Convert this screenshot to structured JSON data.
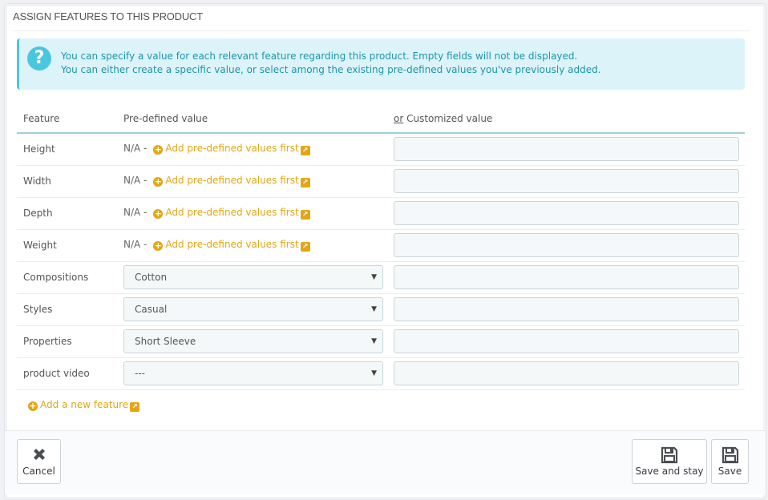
{
  "panel": {
    "title": "Assign features to this product"
  },
  "alert": {
    "icon": "question-circle-icon",
    "line1": "You can specify a value for each relevant feature regarding this product. Empty fields will not be displayed.",
    "line2": "You can either create a specific value, or select among the existing pre-defined values you've previously added."
  },
  "table": {
    "headers": {
      "feature": "Feature",
      "predefined": "Pre-defined value",
      "or": "or",
      "custom": "Customized value"
    },
    "na_label": "N/A -",
    "add_predefined_label": "Add pre-defined values first",
    "rows": [
      {
        "feature": "Height",
        "type": "na",
        "custom_value": ""
      },
      {
        "feature": "Width",
        "type": "na",
        "custom_value": ""
      },
      {
        "feature": "Depth",
        "type": "na",
        "custom_value": ""
      },
      {
        "feature": "Weight",
        "type": "na",
        "custom_value": ""
      },
      {
        "feature": "Compositions",
        "type": "select",
        "selected": "Cotton",
        "custom_value": ""
      },
      {
        "feature": "Styles",
        "type": "select",
        "selected": "Casual",
        "custom_value": ""
      },
      {
        "feature": "Properties",
        "type": "select",
        "selected": "Short Sleeve",
        "custom_value": ""
      },
      {
        "feature": "product video",
        "type": "select",
        "selected": "---",
        "custom_value": ""
      }
    ]
  },
  "add_feature_label": "Add a new feature",
  "footer": {
    "cancel_label": "Cancel",
    "save_and_stay_label": "Save and stay",
    "save_label": "Save"
  },
  "colors": {
    "accent_link": "#e3a614",
    "info_bg": "#dcf4f9",
    "info_text": "#1e94ab"
  }
}
